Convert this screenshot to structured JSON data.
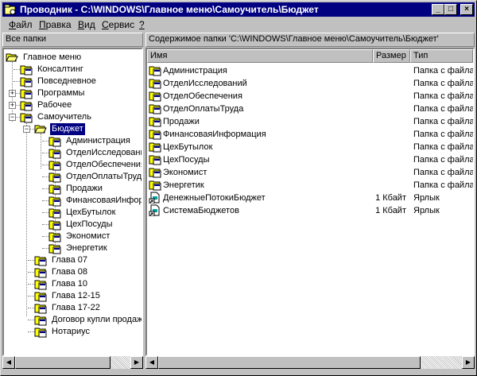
{
  "window": {
    "title": "Проводник - C:\\WINDOWS\\Главное меню\\Самоучитель\\Бюджет",
    "minimize": "_",
    "maximize": "□",
    "close": "×"
  },
  "menu": [
    {
      "label": "Файл",
      "accel": "Ф",
      "rest": "айл"
    },
    {
      "label": "Правка",
      "accel": "П",
      "rest": "равка"
    },
    {
      "label": "Вид",
      "accel": "В",
      "rest": "ид"
    },
    {
      "label": "Сервис",
      "accel": "С",
      "rest": "ервис"
    },
    {
      "label": "?",
      "accel": "?",
      "rest": ""
    }
  ],
  "left_pane": {
    "header": "Все папки",
    "tree": [
      {
        "label": "Главное меню"
      },
      {
        "label": "Консалтинг"
      },
      {
        "label": "Повседневное"
      },
      {
        "label": "Программы"
      },
      {
        "label": "Рабочее"
      },
      {
        "label": "Самоучитель"
      },
      {
        "label": "Бюджет"
      },
      {
        "label": "Администрация"
      },
      {
        "label": "ОтделИсследований"
      },
      {
        "label": "ОтделОбеспечения"
      },
      {
        "label": "ОтделОплатыТруда"
      },
      {
        "label": "Продажи"
      },
      {
        "label": "ФинансоваяИнформация"
      },
      {
        "label": "ЦехБутылок"
      },
      {
        "label": "ЦехПосуды"
      },
      {
        "label": "Экономист"
      },
      {
        "label": "Энергетик"
      },
      {
        "label": "Глава 07"
      },
      {
        "label": "Глава 08"
      },
      {
        "label": "Глава 10"
      },
      {
        "label": "Глава 12-15"
      },
      {
        "label": "Глава 17-22"
      },
      {
        "label": "Договор купли продажи"
      },
      {
        "label": "Нотариус"
      }
    ]
  },
  "right_pane": {
    "header": "Содержимое папки 'C:\\WINDOWS\\Главное меню\\Самоучитель\\Бюджет'",
    "columns": {
      "name": "Имя",
      "size": "Размер",
      "type": "Тип"
    },
    "items": [
      {
        "name": "Администрация",
        "size": "",
        "type": "Папка с файлами"
      },
      {
        "name": "ОтделИсследований",
        "size": "",
        "type": "Папка с файлами"
      },
      {
        "name": "ОтделОбеспечения",
        "size": "",
        "type": "Папка с файлами"
      },
      {
        "name": "ОтделОплатыТруда",
        "size": "",
        "type": "Папка с файлами"
      },
      {
        "name": "Продажи",
        "size": "",
        "type": "Папка с файлами"
      },
      {
        "name": "ФинансоваяИнформация",
        "size": "",
        "type": "Папка с файлами"
      },
      {
        "name": "ЦехБутылок",
        "size": "",
        "type": "Папка с файлами"
      },
      {
        "name": "ЦехПосуды",
        "size": "",
        "type": "Папка с файлами"
      },
      {
        "name": "Экономист",
        "size": "",
        "type": "Папка с файлами"
      },
      {
        "name": "Энергетик",
        "size": "",
        "type": "Папка с файлами"
      },
      {
        "name": "ДенежныеПотокиБюджет",
        "size": "1 Кбайт",
        "type": "Ярлык"
      },
      {
        "name": "СистемаБюджетов",
        "size": "1 Кбайт",
        "type": "Ярлык"
      }
    ]
  },
  "colors": {
    "title_bar": "#000080",
    "face": "#c0c0c0",
    "folder": "#ffff00"
  }
}
